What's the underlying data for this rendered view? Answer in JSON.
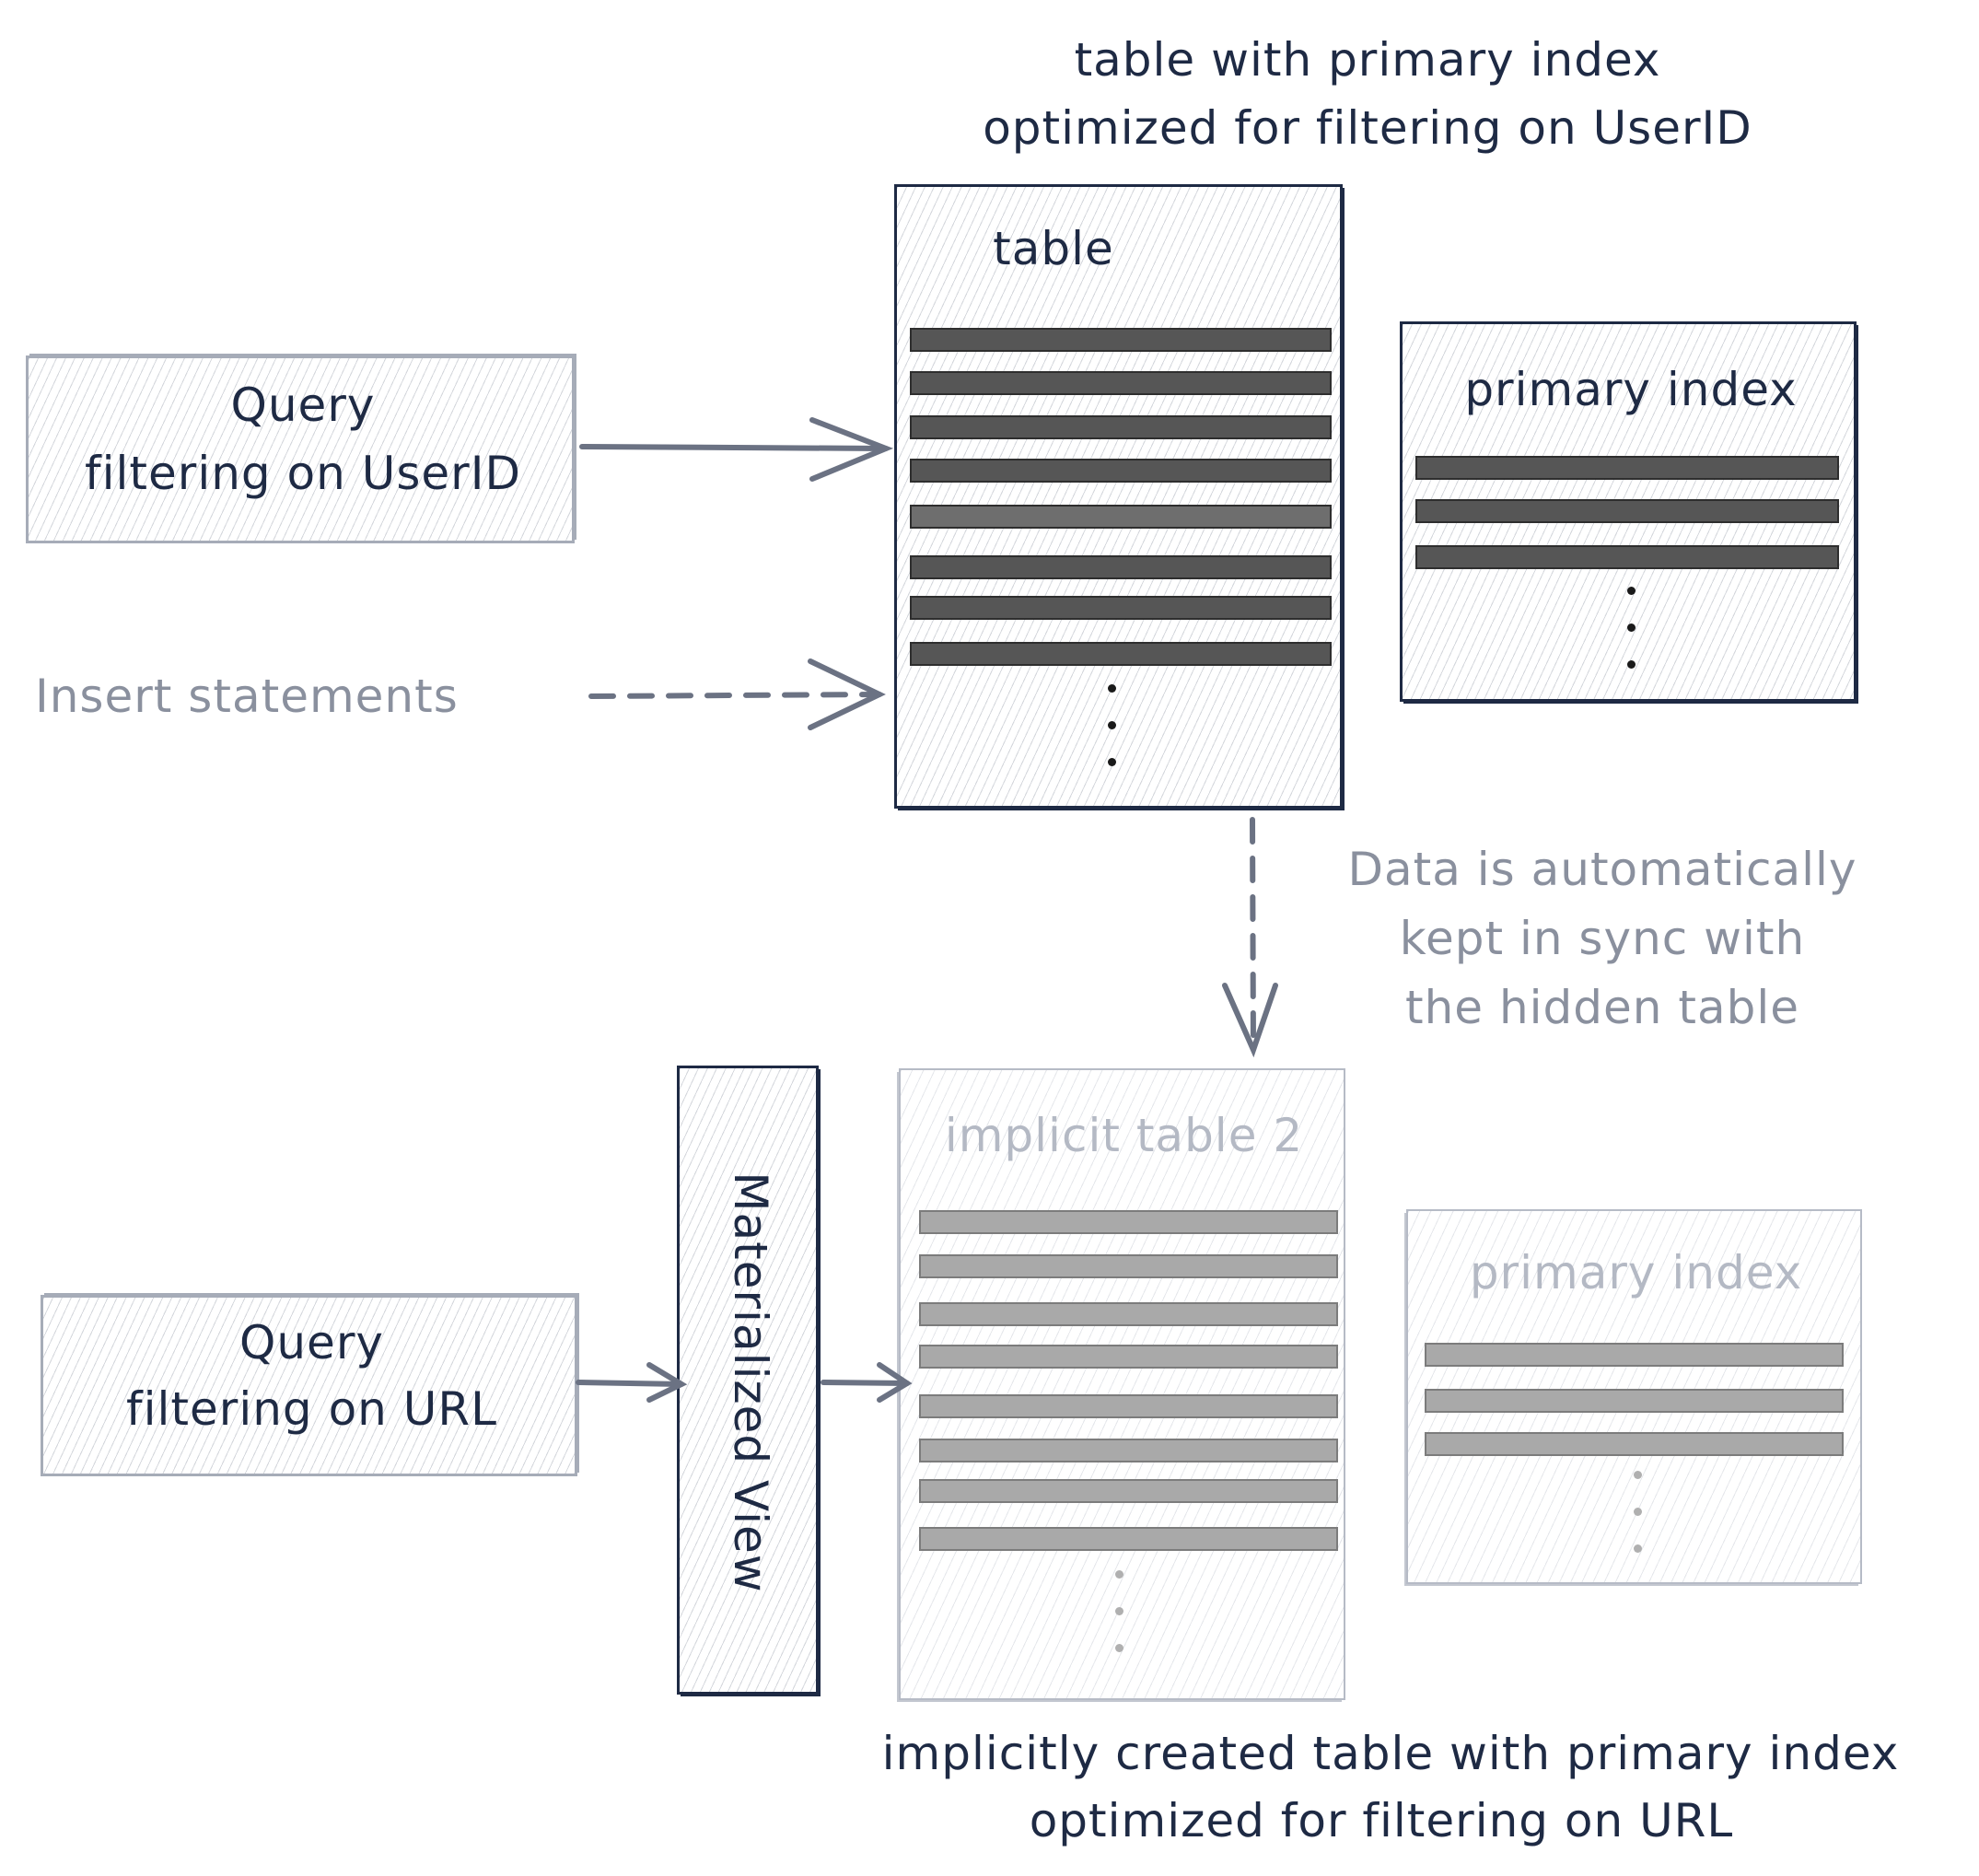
{
  "diagram": {
    "top_caption": {
      "line1": "table with primary index",
      "line2": "optimized for filtering on UserID"
    },
    "source_table": {
      "label": "table",
      "row_count_visible": 8,
      "continuation": "⋮"
    },
    "source_primary_index": {
      "label": "primary index",
      "row_count_visible": 3
    },
    "query_userid": {
      "line1": "Query",
      "line2": "filtering on UserID"
    },
    "insert_statements": {
      "label": "Insert statements"
    },
    "sync_note": {
      "line1": "Data is automatically",
      "line2": "kept in sync with",
      "line3": "the hidden table"
    },
    "materialized_view": {
      "label": "Materialized View"
    },
    "implicit_table": {
      "label": "implicit table 2",
      "row_count_visible": 8
    },
    "implicit_primary_index": {
      "label": "primary index",
      "row_count_visible": 3
    },
    "query_url": {
      "line1": "Query",
      "line2": "filtering on URL"
    },
    "bottom_caption": {
      "line1": "implicitly created table with primary index",
      "line2": "optimized for filtering on URL"
    },
    "colors": {
      "ink": "#1e2a44",
      "arrow": "#6b7283",
      "muted_text": "#8a909e",
      "faint": "#b4b9c4",
      "row_dark": "#565656",
      "row_grey": "#a9a9a9"
    }
  }
}
